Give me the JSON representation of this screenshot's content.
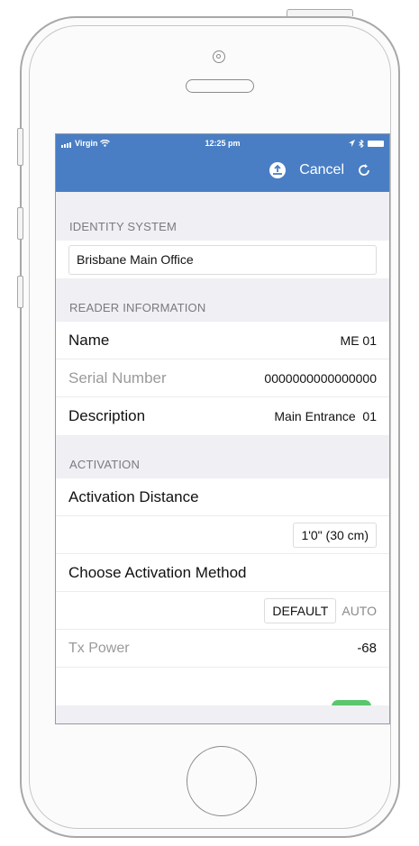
{
  "status_bar": {
    "carrier": "Virgin",
    "time": "12:25 pm"
  },
  "nav": {
    "cancel_label": "Cancel",
    "icons": [
      "upload-icon",
      "refresh-icon"
    ]
  },
  "identity_system": {
    "header": "IDENTITY SYSTEM",
    "value": "Brisbane Main Office"
  },
  "reader_information": {
    "header": "READER INFORMATION",
    "rows": [
      {
        "label": "Name",
        "value": "ME 01"
      },
      {
        "label": "Serial Number",
        "value": "0000000000000000"
      },
      {
        "label": "Description",
        "value": "Main Entrance  01"
      }
    ]
  },
  "activation": {
    "header": "ACTIVATION",
    "distance_label": "Activation Distance",
    "distance_value": "1'0\" (30 cm)",
    "method_label": "Choose Activation Method",
    "method_selected": "DEFAULT",
    "method_other": "AUTO",
    "tx_power_label": "Tx Power",
    "tx_power_value": "-68"
  },
  "colors": {
    "nav_bar": "#4a7ec4",
    "toggle_on": "#5ac76a"
  }
}
